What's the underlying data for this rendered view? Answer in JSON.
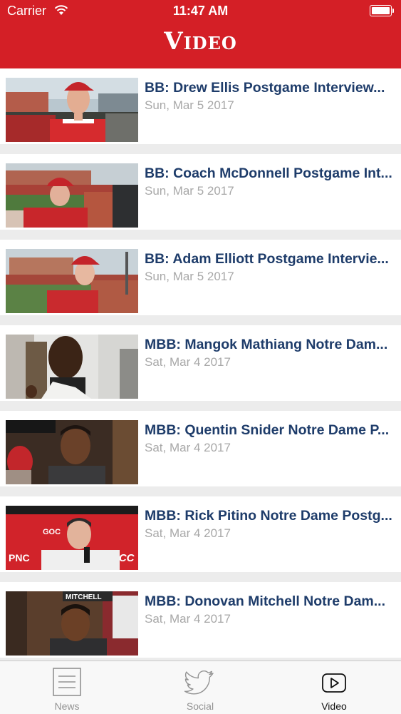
{
  "status_bar": {
    "carrier": "Carrier",
    "time": "11:47 AM"
  },
  "header": {
    "title": "Video"
  },
  "videos": [
    {
      "title": "BB: Drew Ellis Postgame Interview...",
      "date": "Sun, Mar 5 2017"
    },
    {
      "title": "BB: Coach McDonnell Postgame Int...",
      "date": "Sun, Mar 5 2017"
    },
    {
      "title": "BB: Adam Elliott Postgame Intervie...",
      "date": "Sun, Mar 5 2017"
    },
    {
      "title": "MBB: Mangok Mathiang Notre Dam...",
      "date": "Sat, Mar 4 2017"
    },
    {
      "title": "MBB: Quentin Snider Notre Dame P...",
      "date": "Sat, Mar 4 2017"
    },
    {
      "title": "MBB: Rick Pitino Notre Dame Postg...",
      "date": "Sat, Mar 4 2017"
    },
    {
      "title": "MBB: Donovan Mitchell Notre Dam...",
      "date": "Sat, Mar 4 2017"
    }
  ],
  "thumb_text": {
    "pitino_banner": "GOC",
    "pitino_sponsor": "PNC",
    "pitino_logo": "ACC",
    "mitchell_banner": "MITCHELL"
  },
  "tabs": [
    {
      "label": "News",
      "icon": "news-icon",
      "active": false
    },
    {
      "label": "Social",
      "icon": "twitter-bird-icon",
      "active": false
    },
    {
      "label": "Video",
      "icon": "play-icon",
      "active": true
    }
  ],
  "colors": {
    "header_red": "#d41f26",
    "title_navy": "#1e3c6a",
    "date_gray": "#a8a8a8",
    "background": "#ececec"
  }
}
